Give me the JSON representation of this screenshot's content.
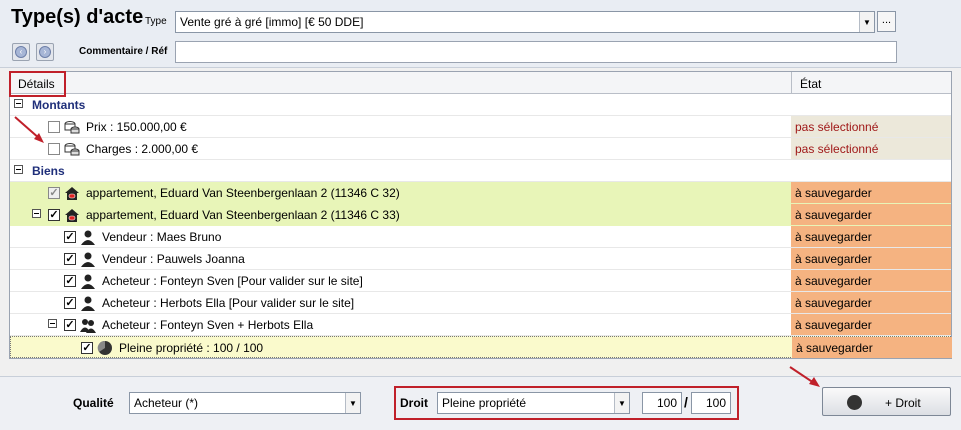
{
  "header": {
    "title": "Type(s) d'acte",
    "type_label": "Type",
    "type_value": "Vente gré à gré [immo] [€ 50 DDE]",
    "ellipsis_label": "...",
    "comment_label": "Commentaire / Réf",
    "comment_value": ""
  },
  "grid": {
    "columns": [
      "Détails",
      "État"
    ],
    "sections": [
      {
        "title": "Montants",
        "rows": [
          {
            "label": "Prix : 150.000,00 €",
            "state": "pas sélectionné"
          },
          {
            "label": "Charges : 2.000,00 €",
            "state": "pas sélectionné"
          }
        ]
      },
      {
        "title": "Biens",
        "rows": [
          {
            "label": "appartement, Eduard Van Steenbergenlaan 2 (11346 C 32)",
            "state": "à sauvegarder"
          },
          {
            "label": "appartement, Eduard Van Steenbergenlaan 2 (11346 C 33)",
            "state": "à sauvegarder"
          },
          {
            "label": "Vendeur : Maes Bruno",
            "state": "à sauvegarder"
          },
          {
            "label": "Vendeur : Pauwels Joanna",
            "state": "à sauvegarder"
          },
          {
            "label": "Acheteur : Fonteyn Sven [Pour valider sur le site]",
            "state": "à sauvegarder"
          },
          {
            "label": "Acheteur : Herbots Ella [Pour valider sur le site]",
            "state": "à sauvegarder"
          },
          {
            "label": "Acheteur : Fonteyn Sven + Herbots Ella",
            "state": "à sauvegarder"
          },
          {
            "label": "Pleine propriété : 100 / 100",
            "state": "à sauvegarder"
          }
        ]
      }
    ]
  },
  "footer": {
    "qualite_label": "Qualité",
    "qualite_value": "Acheteur (*)",
    "droit_label": "Droit",
    "droit_value": "Pleine propriété",
    "numerator": "100",
    "slash": "/",
    "denominator": "100",
    "add_droit_label": "+ Droit"
  },
  "colors": {
    "state_orange": "#f5b381",
    "state_grey": "#ece8da",
    "green_row": "#e8f5b8",
    "annotation_red": "#c0202a"
  }
}
